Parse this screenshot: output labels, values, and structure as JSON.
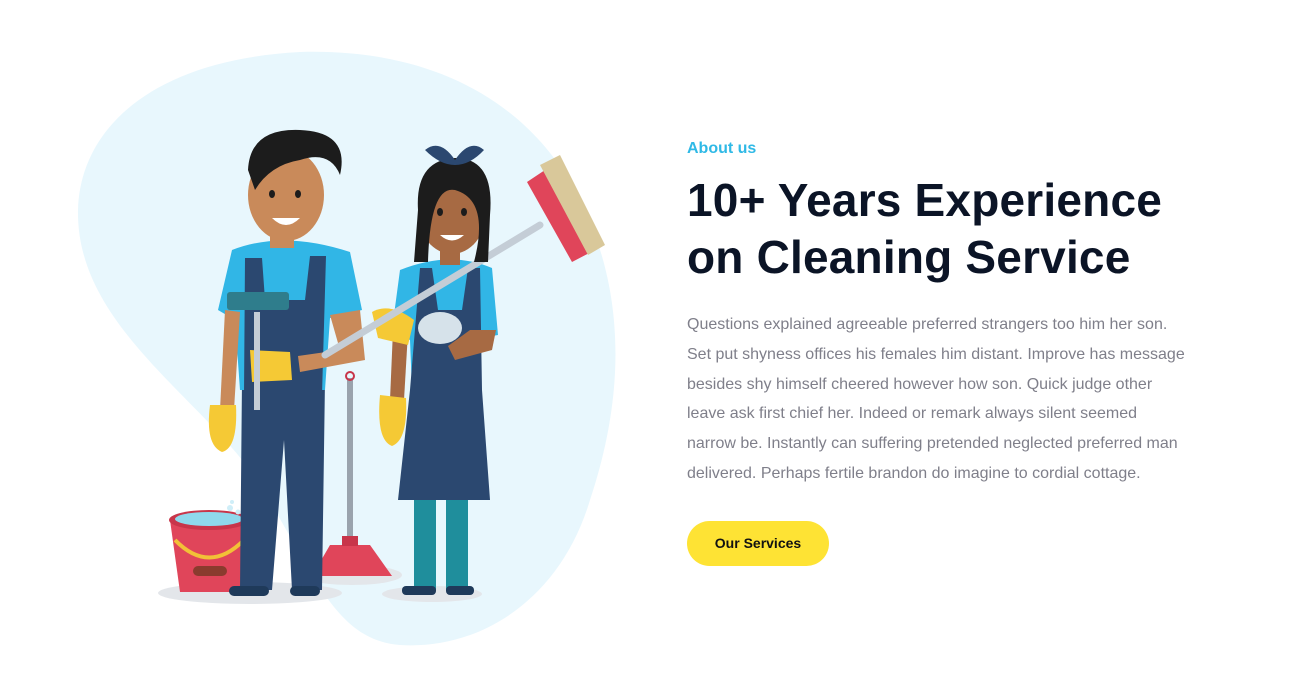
{
  "about": {
    "eyebrow": "About us",
    "headline_line1": "10+ Years Experience",
    "headline_line2": "on Cleaning Service",
    "body_lines": [
      "Questions explained agreeable preferred strangers too him her son.",
      "Set put shyness offices his females him distant. Improve has message",
      "besides shy himself cheered however how son. Quick judge other",
      "leave ask first chief her. Indeed or remark always silent seemed",
      "narrow be. Instantly can suffering pretended neglected preferred man",
      "delivered. Perhaps fertile brandon do imagine to cordial cottage."
    ],
    "cta_label": "Our Services"
  },
  "colors": {
    "accent": "#2fb9e6",
    "heading": "#0b1426",
    "body": "#7f7f8a",
    "button": "#fee334",
    "blob": "#e8f7fd"
  },
  "illustration": {
    "subject": "two-cleaners-illustration"
  }
}
